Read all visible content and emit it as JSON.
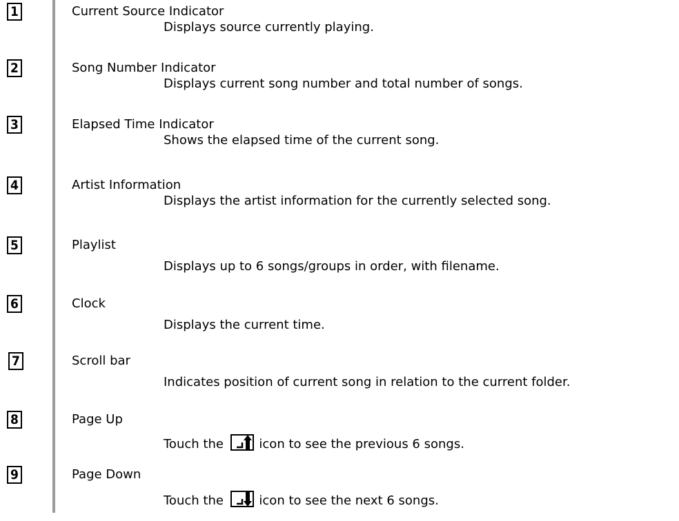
{
  "entries": [
    {
      "num": "1",
      "title": "Current Source Indicator",
      "desc": "Displays source currently playing."
    },
    {
      "num": "2",
      "title": "Song Number Indicator",
      "desc": "Displays current song number and total number of songs."
    },
    {
      "num": "3",
      "title": "Elapsed Time Indicator",
      "desc": "Shows the elapsed time of the current song."
    },
    {
      "num": "4",
      "title": "Artist Information",
      "desc": "Displays the artist information for the currently selected song."
    },
    {
      "num": "5",
      "title": "Playlist",
      "desc": "Displays up to 6 songs/groups in order, with filename."
    },
    {
      "num": "6",
      "title": "Clock",
      "desc": "Displays the current time."
    },
    {
      "num": "7",
      "title": "Scroll bar",
      "desc": "Indicates position of current song in relation to the current folder."
    },
    {
      "num": "8",
      "title": "Page Up",
      "desc_before": "Touch the",
      "desc_after": "icon to see the previous 6 songs.",
      "icon": "page-up-icon"
    },
    {
      "num": "9",
      "title": "Page Down",
      "desc_before": "Touch the",
      "desc_after": "icon to see the next 6 songs.",
      "icon": "page-down-icon"
    }
  ]
}
